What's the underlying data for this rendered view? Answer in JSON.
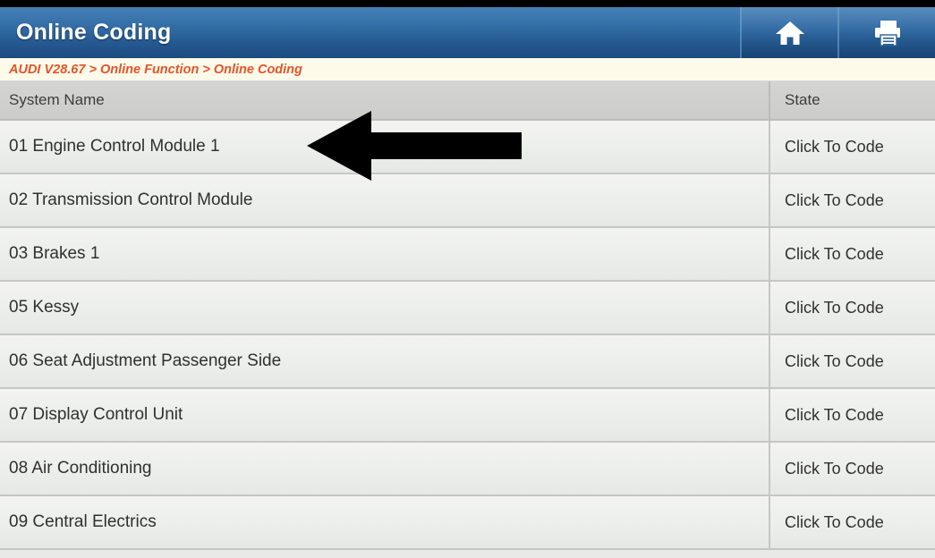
{
  "window": {
    "title": "Online Coding"
  },
  "header": {
    "title": "Online Coding",
    "buttons": [
      {
        "name": "home-button",
        "icon": "home-icon",
        "label": "Home"
      },
      {
        "name": "print-button",
        "icon": "printer-icon",
        "label": "Print"
      }
    ],
    "background_color": "#2f6aa4",
    "text_color": "#ffffff"
  },
  "breadcrumb": {
    "text": "AUDI V28.67 > Online Function > Online Coding",
    "color": "#e2552a",
    "background_color": "#fdfaea"
  },
  "table": {
    "columns": [
      {
        "key": "system_name",
        "label": "System Name"
      },
      {
        "key": "state",
        "label": "State"
      }
    ],
    "rows": [
      {
        "system_name": "01 Engine Control Module 1",
        "state": "Click To Code"
      },
      {
        "system_name": "02 Transmission Control Module",
        "state": "Click To Code"
      },
      {
        "system_name": "03 Brakes 1",
        "state": "Click To Code"
      },
      {
        "system_name": "05 Kessy",
        "state": "Click To Code"
      },
      {
        "system_name": "06 Seat Adjustment Passenger Side",
        "state": "Click To Code"
      },
      {
        "system_name": "07 Display Control Unit",
        "state": "Click To Code"
      },
      {
        "system_name": "08 Air Conditioning",
        "state": "Click To Code"
      },
      {
        "system_name": "09 Central Electrics",
        "state": "Click To Code"
      }
    ],
    "header_background_color": "#d0d1cf",
    "row_background_color": "#eff0ee"
  },
  "annotation": {
    "arrow": {
      "name": "left-arrow-annotation",
      "direction": "left",
      "color": "#000000",
      "points_at": "01 Engine Control Module 1"
    }
  }
}
